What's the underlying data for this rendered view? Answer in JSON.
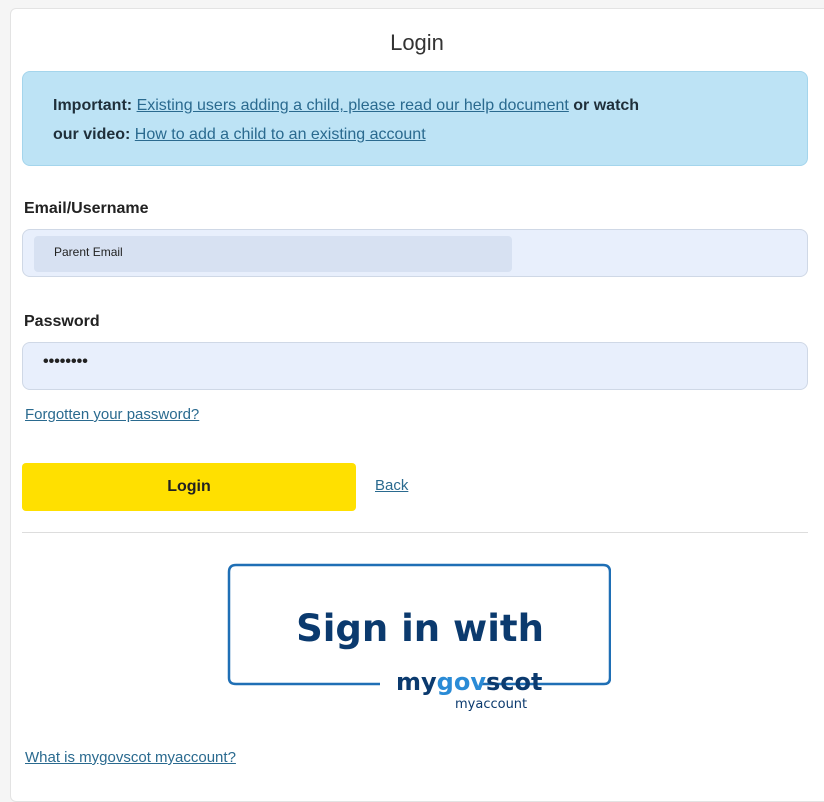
{
  "login": {
    "title": "Login",
    "notice": {
      "important_label": "Important:",
      "help_link": "Existing users adding a child, please read our help document",
      "middle_text": "or watch",
      "our_video": "our video:",
      "video_link": "How to add a child to an existing account"
    },
    "email": {
      "label": "Email/Username",
      "value": "Parent Email"
    },
    "password": {
      "label": "Password",
      "masked_value": "••••••••"
    },
    "forgot_link": "Forgotten your password?",
    "login_button": "Login",
    "back_link": "Back",
    "sso": {
      "sign_in_with": "Sign in with",
      "brand_my": "my",
      "brand_gov": "gov",
      "brand_scot": "scot",
      "brand_sub": "myaccount"
    },
    "what_is_link": "What is mygovscot myaccount?"
  },
  "colors": {
    "accent_yellow": "#ffe000",
    "notice_blue": "#bde3f5",
    "link_blue": "#2a6a8f",
    "brand_navy": "#0b3a6e"
  }
}
